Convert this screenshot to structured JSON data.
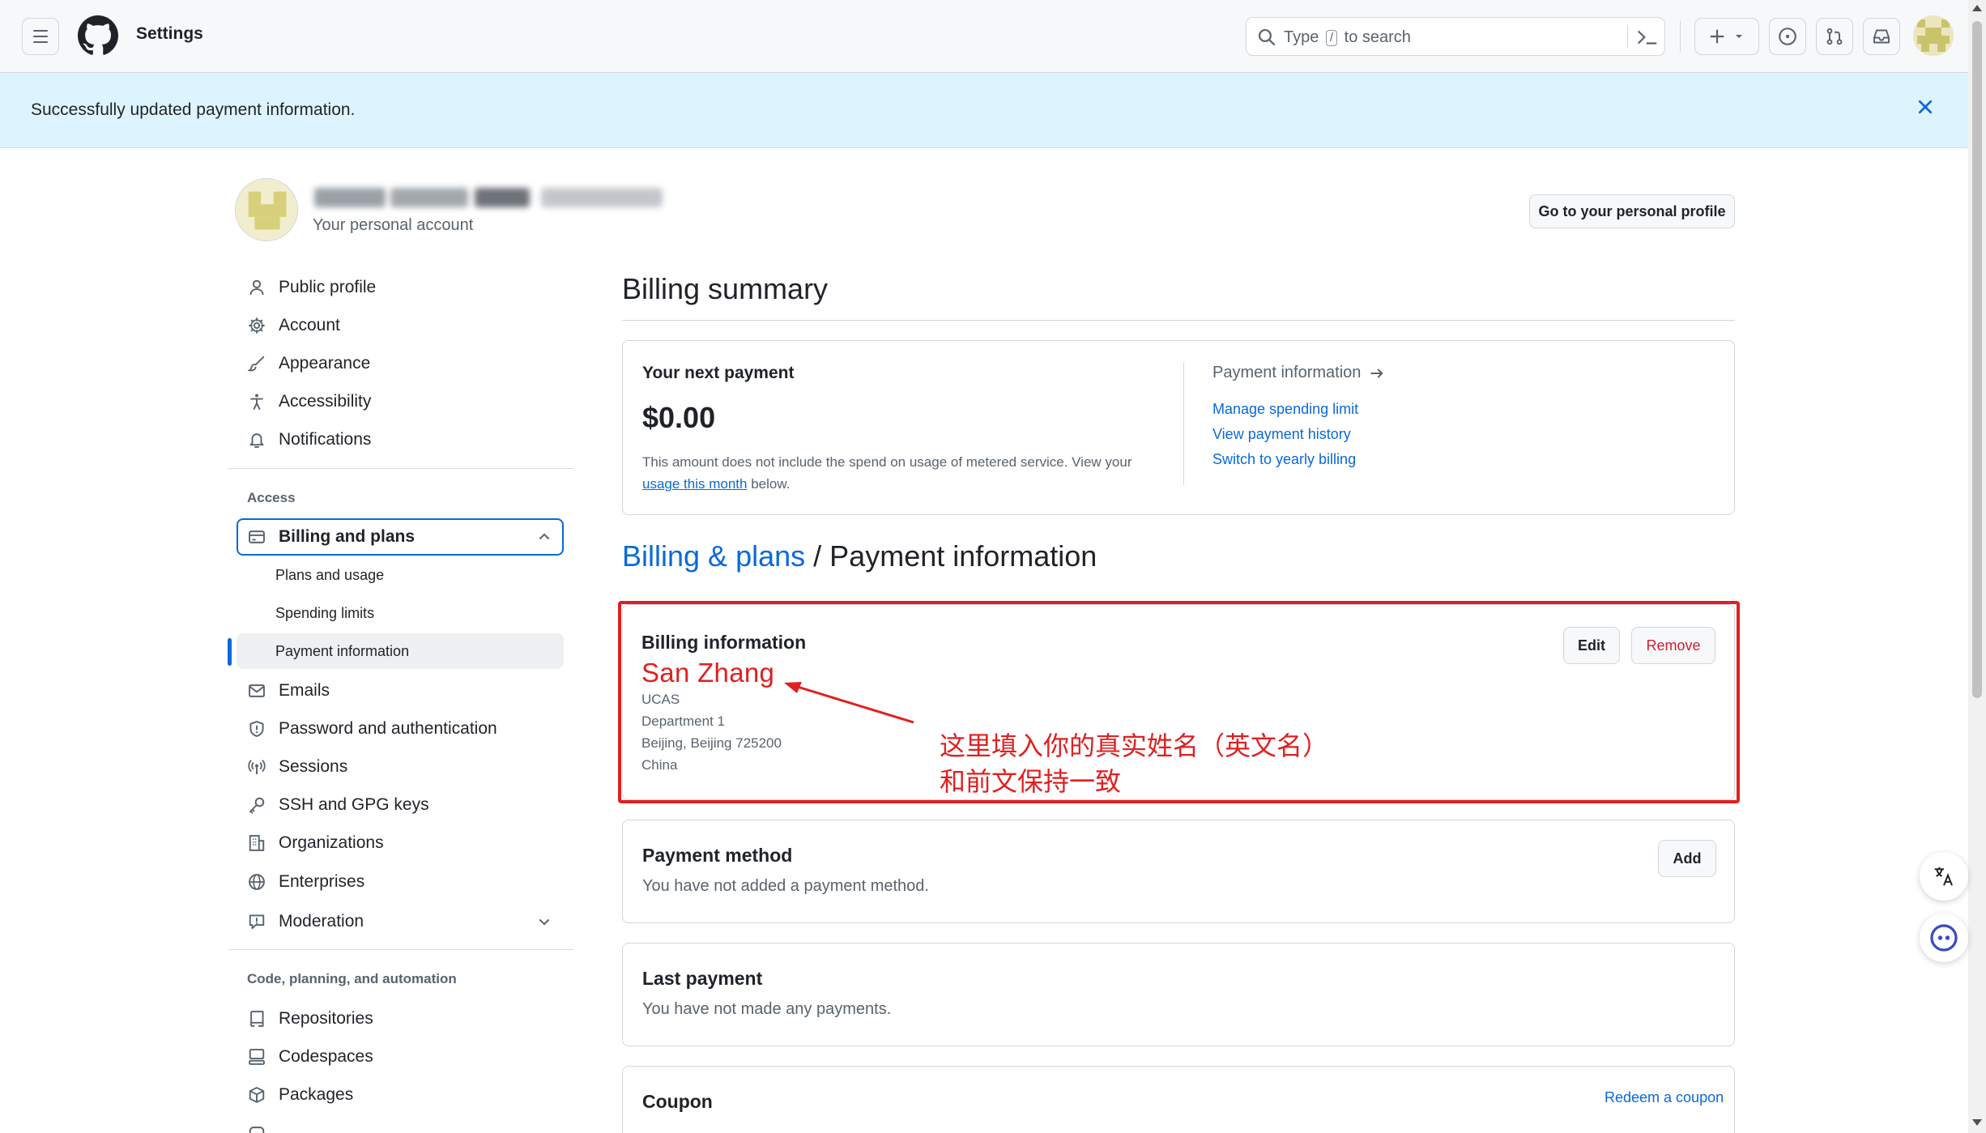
{
  "header": {
    "title": "Settings",
    "search_prefix": "Type",
    "search_key": "/",
    "search_suffix": "to search",
    "avatar_icon": "identicon"
  },
  "flash": {
    "message": "Successfully updated payment information."
  },
  "account": {
    "subtitle": "Your personal account",
    "profile_button": "Go to your personal profile"
  },
  "sidebar": {
    "top_items": [
      {
        "label": "Public profile",
        "icon": "person-icon"
      },
      {
        "label": "Account",
        "icon": "gear-icon"
      },
      {
        "label": "Appearance",
        "icon": "paintbrush-icon"
      },
      {
        "label": "Accessibility",
        "icon": "accessibility-icon"
      },
      {
        "label": "Notifications",
        "icon": "bell-icon"
      }
    ],
    "access_heading": "Access",
    "billing_group": "Billing and plans",
    "billing_sub": [
      "Plans and usage",
      "Spending limits",
      "Payment information"
    ],
    "access_items": [
      {
        "label": "Emails",
        "icon": "mail-icon"
      },
      {
        "label": "Password and authentication",
        "icon": "shield-icon"
      },
      {
        "label": "Sessions",
        "icon": "broadcast-icon"
      },
      {
        "label": "SSH and GPG keys",
        "icon": "key-icon"
      },
      {
        "label": "Organizations",
        "icon": "organization-icon"
      },
      {
        "label": "Enterprises",
        "icon": "globe-icon"
      },
      {
        "label": "Moderation",
        "icon": "report-icon"
      }
    ],
    "code_heading": "Code, planning, and automation",
    "code_items": [
      {
        "label": "Repositories",
        "icon": "repo-icon"
      },
      {
        "label": "Codespaces",
        "icon": "codespaces-icon"
      },
      {
        "label": "Packages",
        "icon": "package-icon"
      }
    ]
  },
  "billing_summary": {
    "heading": "Billing summary",
    "next_payment_title": "Your next payment",
    "amount": "$0.00",
    "note_before": "This amount does not include the spend on usage of metered service. View your",
    "note_link": "usage this month",
    "note_after": "below.",
    "payment_info_link": "Payment information",
    "links": [
      "Manage spending limit",
      "View payment history",
      "Switch to yearly billing"
    ]
  },
  "breadcrumb": {
    "parent": "Billing & plans",
    "separator": "/",
    "current": "Payment information"
  },
  "billing_info": {
    "title": "Billing information",
    "name": "San Zhang",
    "lines": [
      "UCAS",
      "Department 1",
      "Beijing, Beijing 725200",
      "China"
    ],
    "edit_button": "Edit",
    "remove_button": "Remove"
  },
  "annotation": {
    "line1": "这里填入你的真实姓名（英文名）",
    "line2": "和前文保持一致",
    "color": "#e02020"
  },
  "payment_method": {
    "title": "Payment method",
    "text": "You have not added a payment method.",
    "add_button": "Add"
  },
  "last_payment": {
    "title": "Last payment",
    "text": "You have not made any payments."
  },
  "coupon": {
    "title": "Coupon",
    "link": "Redeem a coupon"
  },
  "colors": {
    "accent": "#0969da",
    "flash_bg": "#ddf4ff",
    "danger": "#cf222e"
  }
}
